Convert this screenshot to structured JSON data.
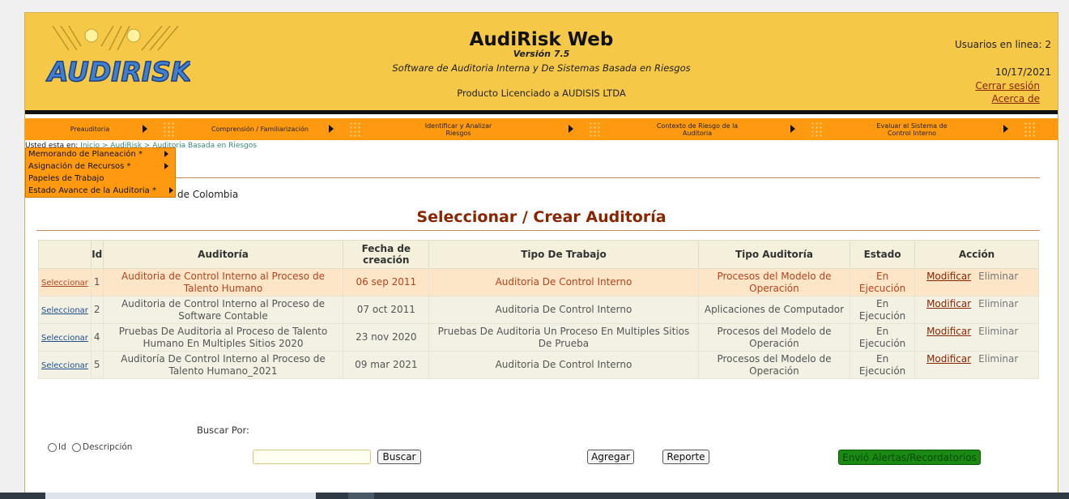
{
  "header": {
    "logo_text": "AUDIRISK",
    "title": "AudiRisk Web",
    "version": "Versión 7.5",
    "subtitle": "Software de Auditoria Interna y De Sistemas Basada en Riesgos",
    "license": "Producto Licenciado a AUDISIS LTDA",
    "users_online": "Usuarios en linea: 2",
    "date": "10/17/2021",
    "logout_label": "Cerrar sesión",
    "about_label": "Acerca de"
  },
  "menu": {
    "items": [
      {
        "label": "Preauditoria"
      },
      {
        "label": "Comprensión / Familiarización"
      },
      {
        "label": "Identificar y Analizar Riesgos"
      },
      {
        "label": "Contexto de Riesgo de la Auditoria"
      },
      {
        "label": "Evaluar el Sistema de Control Interno"
      }
    ]
  },
  "submenu": {
    "items": [
      {
        "label": "Memorando de Planeación *"
      },
      {
        "label": "Asignación de Recursos *"
      },
      {
        "label": "Papeles de Trabajo"
      },
      {
        "label": "Estado Avance de la Auditoria *"
      }
    ]
  },
  "breadcrumb": {
    "prefix": "Usted esta en:",
    "home": "Inicio",
    "sep1": " > ",
    "app": "AudiRisk",
    "sep2": " > ",
    "current": "Auditoria Basada en Riesgos"
  },
  "company": "de Colombia",
  "section_title": "Seleccionar / Crear Auditoría",
  "table": {
    "headers": {
      "select": "",
      "id": "Id",
      "audit": "Auditoría",
      "date": "Fecha de creación",
      "work_type": "Tipo De Trabajo",
      "audit_type": "Tipo Auditoría",
      "status": "Estado",
      "action": "Acción"
    },
    "rows": [
      {
        "select": "Seleccionar",
        "id": "1",
        "audit": "Auditoria de Control Interno al Proceso de Talento Humano",
        "date": "06 sep 2011",
        "work_type": "Auditoria De Control Interno",
        "audit_type": "Procesos del Modelo de Operación",
        "status": "En Ejecución",
        "modify": "Modificar",
        "delete": "Eliminar"
      },
      {
        "select": "Seleccionar",
        "id": "2",
        "audit": "Auditoria de Control Interno al Proceso de Software Contable",
        "date": "07 oct 2011",
        "work_type": "Auditoria De Control Interno",
        "audit_type": "Aplicaciones de Computador",
        "status": "En Ejecución",
        "modify": "Modificar",
        "delete": "Eliminar"
      },
      {
        "select": "Seleccionar",
        "id": "4",
        "audit": "Pruebas De Auditoria al Proceso de Talento Humano En Multiples Sitios 2020",
        "date": "23 nov 2020",
        "work_type": "Pruebas De Auditoria Un Proceso En Multiples Sitios De Prueba",
        "audit_type": "Procesos del Modelo de Operación",
        "status": "En Ejecución",
        "modify": "Modificar",
        "delete": "Eliminar"
      },
      {
        "select": "Seleccionar",
        "id": "5",
        "audit": "Auditoría De Control Interno al Proceso de Talento Humano_2021",
        "date": "09 mar 2021",
        "work_type": "Auditoria De Control Interno",
        "audit_type": "Procesos del Modelo de Operación",
        "status": "En Ejecución",
        "modify": "Modificar",
        "delete": "Eliminar"
      }
    ]
  },
  "search": {
    "label": "Buscar Por:",
    "option_id": "Id",
    "option_desc": "Descripción",
    "input_value": "",
    "search_button": "Buscar"
  },
  "buttons": {
    "add": "Agregar",
    "report": "Reporte",
    "alerts": "Envió Alertas/Recordatorios"
  }
}
